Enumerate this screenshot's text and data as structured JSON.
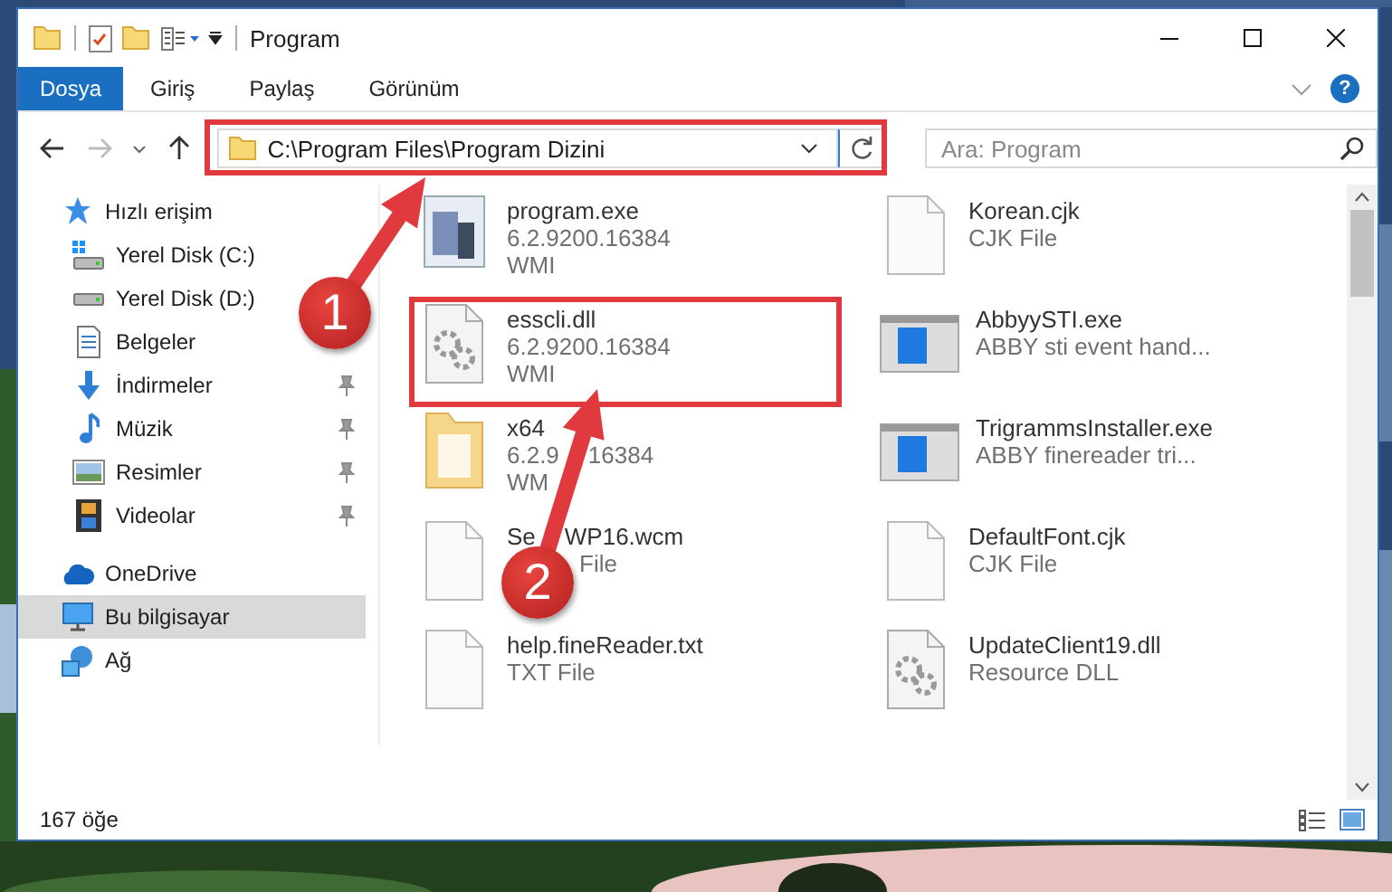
{
  "window": {
    "title": "Program"
  },
  "ribbon": {
    "tabs": [
      {
        "label": "Dosya",
        "selected": true
      },
      {
        "label": "Giriş",
        "selected": false
      },
      {
        "label": "Paylaş",
        "selected": false
      },
      {
        "label": "Görünüm",
        "selected": false
      }
    ],
    "help": "?"
  },
  "address_bar": {
    "path": "C:\\Program Files\\Program Dizini"
  },
  "search": {
    "placeholder": "Ara: Program"
  },
  "sidebar": {
    "items": [
      {
        "label": "Hızlı erişim",
        "kind": "star",
        "selected": false,
        "children": [
          {
            "label": "Yerel Disk (C:)",
            "kind": "windrive",
            "pinned": false,
            "selected": false
          },
          {
            "label": "Yerel Disk (D:)",
            "kind": "drive",
            "pinned": false,
            "selected": false
          },
          {
            "label": "Belgeler",
            "kind": "document",
            "pinned": false,
            "selected": false
          },
          {
            "label": "İndirmeler",
            "kind": "download",
            "pinned": true,
            "selected": false
          },
          {
            "label": "Müzik",
            "kind": "music",
            "pinned": true,
            "selected": false
          },
          {
            "label": "Resimler",
            "kind": "pictures",
            "pinned": true,
            "selected": false
          },
          {
            "label": "Videolar",
            "kind": "video",
            "pinned": true,
            "selected": false
          }
        ]
      },
      {
        "label": "OneDrive",
        "kind": "cloud",
        "selected": false
      },
      {
        "label": "Bu bilgisayar",
        "kind": "computer",
        "selected": true
      },
      {
        "label": "Ağ",
        "kind": "network",
        "selected": false
      }
    ]
  },
  "files": [
    {
      "kind": "exe",
      "name": [
        "program.exe"
      ],
      "details": [
        [
          "6.2.9200.16384"
        ],
        [
          "WMI"
        ]
      ]
    },
    {
      "kind": "blank",
      "name": [
        "Korean.cjk"
      ],
      "details": [
        [
          "CJK File"
        ]
      ]
    },
    {
      "kind": "gears",
      "name": [
        "esscli.dll"
      ],
      "details": [
        [
          "6.2.9200.16384"
        ],
        [
          "WMI"
        ]
      ]
    },
    {
      "kind": "app",
      "name": [
        "AbbyySTI.exe"
      ],
      "details": [
        [
          "ABBY sti event hand..."
        ]
      ]
    },
    {
      "kind": "folder",
      "name": [
        "x64"
      ],
      "details": [
        [
          "6.2.9",
          "16384"
        ],
        [
          "WM"
        ]
      ]
    },
    {
      "kind": "app",
      "name": [
        "TrigrammsInstaller.exe"
      ],
      "details": [
        [
          "ABBY finereader tri..."
        ]
      ]
    },
    {
      "kind": "blank",
      "name": [
        "Se",
        "WP16.wcm"
      ],
      "details": [
        [
          "File"
        ]
      ],
      "details_behind_badge": true
    },
    {
      "kind": "blank",
      "name": [
        "DefaultFont.cjk"
      ],
      "details": [
        [
          "CJK File"
        ]
      ]
    },
    {
      "kind": "blank",
      "name": [
        "help.fineReader.txt"
      ],
      "details": [
        [
          "TXT File"
        ]
      ]
    },
    {
      "kind": "gears",
      "name": [
        "UpdateClient19.dll"
      ],
      "details": [
        [
          "Resource DLL"
        ]
      ]
    }
  ],
  "status_bar": {
    "item_count": "167 öğe"
  },
  "callouts": [
    {
      "number": "1"
    },
    {
      "number": "2"
    }
  ]
}
